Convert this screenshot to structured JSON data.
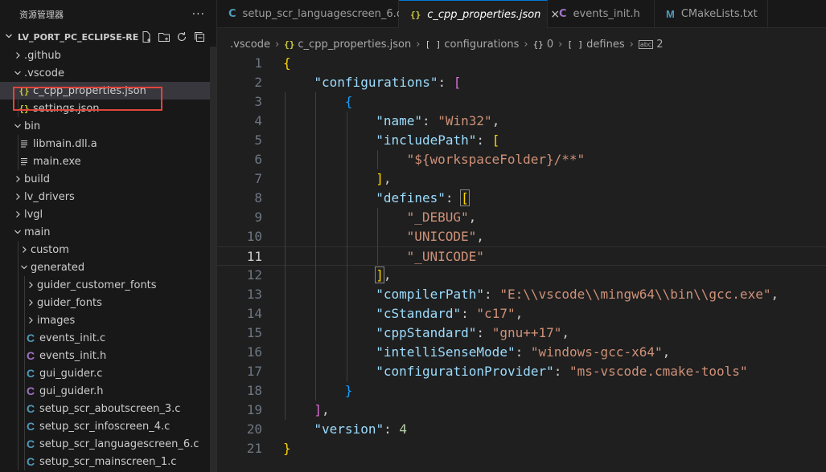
{
  "explorer": {
    "title": "资源管理器",
    "more": "···",
    "project_name": "LV_PORT_PC_ECLIPSE-RE...",
    "tree": [
      {
        "label": ".github",
        "depth": 0,
        "kind": "folder",
        "open": false
      },
      {
        "label": ".vscode",
        "depth": 0,
        "kind": "folder",
        "open": true
      },
      {
        "label": "c_cpp_properties.json",
        "depth": 1,
        "kind": "json",
        "selected": true
      },
      {
        "label": "settings.json",
        "depth": 1,
        "kind": "json"
      },
      {
        "label": "bin",
        "depth": 0,
        "kind": "folder",
        "open": true
      },
      {
        "label": "libmain.dll.a",
        "depth": 1,
        "kind": "file"
      },
      {
        "label": "main.exe",
        "depth": 1,
        "kind": "file"
      },
      {
        "label": "build",
        "depth": 0,
        "kind": "folder",
        "open": false
      },
      {
        "label": "lv_drivers",
        "depth": 0,
        "kind": "folder",
        "open": false
      },
      {
        "label": "lvgl",
        "depth": 0,
        "kind": "folder",
        "open": false
      },
      {
        "label": "main",
        "depth": 0,
        "kind": "folder",
        "open": true
      },
      {
        "label": "custom",
        "depth": 1,
        "kind": "folder",
        "open": false
      },
      {
        "label": "generated",
        "depth": 1,
        "kind": "folder",
        "open": true
      },
      {
        "label": "guider_customer_fonts",
        "depth": 2,
        "kind": "folder",
        "open": false
      },
      {
        "label": "guider_fonts",
        "depth": 2,
        "kind": "folder",
        "open": false
      },
      {
        "label": "images",
        "depth": 2,
        "kind": "folder",
        "open": false
      },
      {
        "label": "events_init.c",
        "depth": 2,
        "kind": "c"
      },
      {
        "label": "events_init.h",
        "depth": 2,
        "kind": "h"
      },
      {
        "label": "gui_guider.c",
        "depth": 2,
        "kind": "c"
      },
      {
        "label": "gui_guider.h",
        "depth": 2,
        "kind": "h"
      },
      {
        "label": "setup_scr_aboutscreen_3.c",
        "depth": 2,
        "kind": "c"
      },
      {
        "label": "setup_scr_infoscreen_4.c",
        "depth": 2,
        "kind": "c"
      },
      {
        "label": "setup_scr_languagescreen_6.c",
        "depth": 2,
        "kind": "c"
      },
      {
        "label": "setup_scr_mainscreen_1.c",
        "depth": 2,
        "kind": "c"
      }
    ]
  },
  "tabs": [
    {
      "label": "setup_scr_languagescreen_6.c",
      "icon": "C",
      "kind": "c",
      "active": false
    },
    {
      "label": "c_cpp_properties.json",
      "icon": "{}",
      "kind": "json",
      "active": true,
      "close": "×"
    },
    {
      "label": "events_init.h",
      "icon": "C",
      "kind": "h",
      "active": false
    },
    {
      "label": "CMakeLists.txt",
      "icon": "M",
      "kind": "m",
      "active": false
    }
  ],
  "breadcrumb": {
    "folder": ".vscode",
    "file": "c_cpp_properties.json",
    "seg1": "configurations",
    "seg2": "0",
    "seg3": "defines",
    "seg4": "2",
    "file_icon": "{}",
    "arr_icon": "[ ]",
    "obj_icon": "{}",
    "str_icon": "abc"
  },
  "editor": {
    "current_line": 11,
    "lines": [
      [
        [
          "b1",
          "{"
        ]
      ],
      [
        [
          "k",
          "\"configurations\""
        ],
        [
          "p",
          ": "
        ],
        [
          "b2",
          "["
        ]
      ],
      [
        [
          "b3",
          "{"
        ]
      ],
      [
        [
          "k",
          "\"name\""
        ],
        [
          "p",
          ": "
        ],
        [
          "s",
          "\"Win32\""
        ],
        [
          "p",
          ","
        ]
      ],
      [
        [
          "k",
          "\"includePath\""
        ],
        [
          "p",
          ": "
        ],
        [
          "b1",
          "["
        ]
      ],
      [
        [
          "s",
          "\"${workspaceFolder}/**\""
        ]
      ],
      [
        [
          "b1",
          "]"
        ],
        [
          "p",
          ","
        ]
      ],
      [
        [
          "k",
          "\"defines\""
        ],
        [
          "p",
          ": "
        ],
        [
          "b1m",
          "["
        ]
      ],
      [
        [
          "s",
          "\"_DEBUG\""
        ],
        [
          "p",
          ","
        ]
      ],
      [
        [
          "s",
          "\"UNICODE\""
        ],
        [
          "p",
          ","
        ]
      ],
      [
        [
          "s",
          "\"_UNICODE\""
        ]
      ],
      [
        [
          "b1m",
          "]"
        ],
        [
          "p",
          ","
        ]
      ],
      [
        [
          "k",
          "\"compilerPath\""
        ],
        [
          "p",
          ": "
        ],
        [
          "s",
          "\"E:\\\\vscode\\\\mingw64\\\\bin\\\\gcc.exe\""
        ],
        [
          "p",
          ","
        ]
      ],
      [
        [
          "k",
          "\"cStandard\""
        ],
        [
          "p",
          ": "
        ],
        [
          "s",
          "\"c17\""
        ],
        [
          "p",
          ","
        ]
      ],
      [
        [
          "k",
          "\"cppStandard\""
        ],
        [
          "p",
          ": "
        ],
        [
          "s",
          "\"gnu++17\""
        ],
        [
          "p",
          ","
        ]
      ],
      [
        [
          "k",
          "\"intelliSenseMode\""
        ],
        [
          "p",
          ": "
        ],
        [
          "s",
          "\"windows-gcc-x64\""
        ],
        [
          "p",
          ","
        ]
      ],
      [
        [
          "k",
          "\"configurationProvider\""
        ],
        [
          "p",
          ": "
        ],
        [
          "s",
          "\"ms-vscode.cmake-tools\""
        ]
      ],
      [
        [
          "b3",
          "}"
        ]
      ],
      [
        [
          "b2",
          "]"
        ],
        [
          "p",
          ","
        ]
      ],
      [
        [
          "k",
          "\"version\""
        ],
        [
          "p",
          ": "
        ],
        [
          "n",
          "4"
        ]
      ],
      [
        [
          "b1",
          "}"
        ]
      ]
    ],
    "indents": [
      0,
      1,
      2,
      3,
      3,
      4,
      3,
      3,
      4,
      4,
      4,
      3,
      3,
      3,
      3,
      3,
      3,
      2,
      1,
      1,
      0
    ]
  }
}
